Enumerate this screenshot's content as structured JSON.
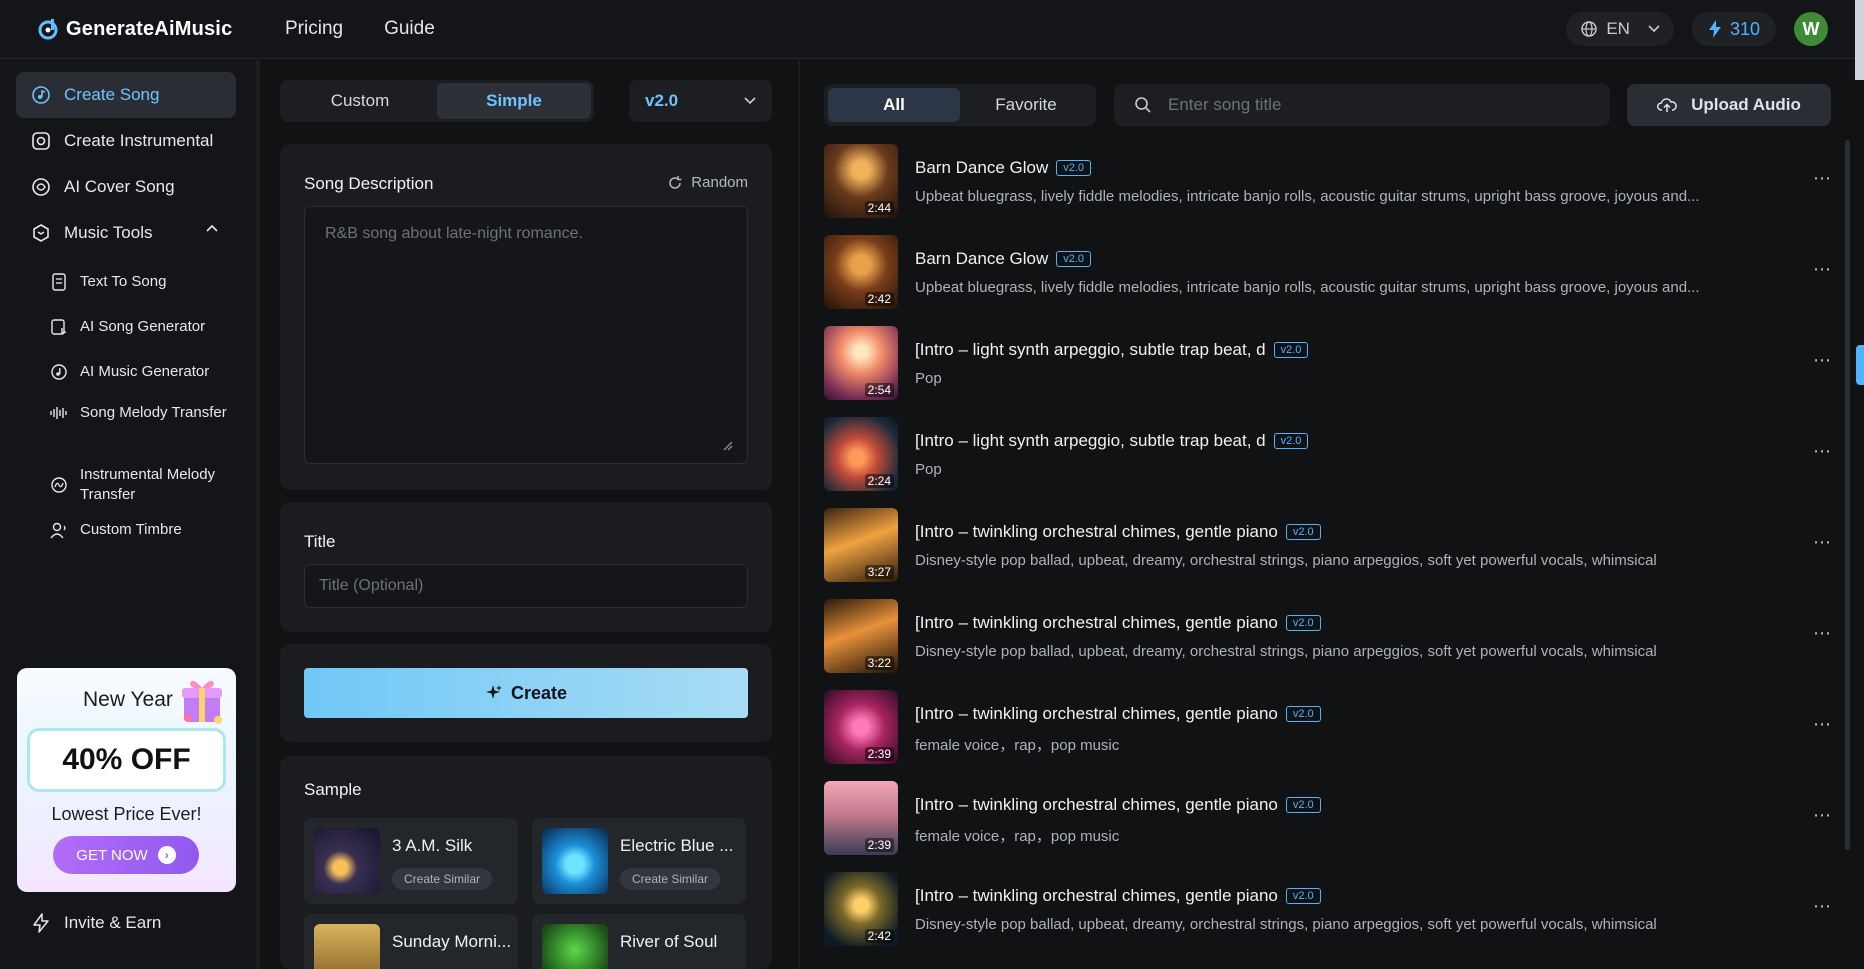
{
  "header": {
    "logo": "GenerateAiMusic",
    "nav": [
      "Pricing",
      "Guide"
    ],
    "language": "EN",
    "credits": "310",
    "avatar_initial": "W"
  },
  "sidebar": {
    "items": [
      {
        "label": "Create Song",
        "icon": "music-note-circle-icon"
      },
      {
        "label": "Create Instrumental",
        "icon": "instrument-icon"
      },
      {
        "label": "AI Cover Song",
        "icon": "cover-song-icon"
      },
      {
        "label": "Music Tools",
        "icon": "tools-icon"
      }
    ],
    "sub_items": [
      {
        "label": "Text To Song",
        "icon": "document-icon"
      },
      {
        "label": "AI Song Generator",
        "icon": "song-generator-icon"
      },
      {
        "label": "AI Music Generator",
        "icon": "music-generator-icon"
      },
      {
        "label": "Song Melody Transfer",
        "icon": "waveform-icon"
      },
      {
        "label": "Instrumental Melody Transfer",
        "icon": "melody-icon"
      },
      {
        "label": "Custom Timbre",
        "icon": "voice-icon"
      }
    ],
    "promo": {
      "title": "New Year",
      "discount": "40% OFF",
      "subtitle": "Lowest Price Ever!",
      "button": "GET NOW"
    },
    "invite": "Invite & Earn"
  },
  "create": {
    "modes": [
      "Custom",
      "Simple"
    ],
    "active_mode": "Simple",
    "version": "v2.0",
    "description_label": "Song Description",
    "random_label": "Random",
    "description_placeholder": "R&B song about late-night romance.",
    "title_label": "Title",
    "title_placeholder": "Title (Optional)",
    "create_label": "Create",
    "sample_label": "Sample",
    "samples": [
      {
        "name": "3 A.M. Silk",
        "action": "Create Similar"
      },
      {
        "name": "Electric Blue ...",
        "action": "Create Similar"
      },
      {
        "name": "Sunday Morni...",
        "action": ""
      },
      {
        "name": "River of Soul",
        "action": ""
      }
    ]
  },
  "library": {
    "tabs": [
      "All",
      "Favorite"
    ],
    "active_tab": "All",
    "search_placeholder": "Enter song title",
    "upload_label": "Upload Audio",
    "songs": [
      {
        "title": "Barn Dance Glow",
        "version": "v2.0",
        "duration": "2:44",
        "desc": "Upbeat bluegrass, lively fiddle melodies, intricate banjo rolls, acoustic guitar strums, upright bass groove, joyous and..."
      },
      {
        "title": "Barn Dance Glow",
        "version": "v2.0",
        "duration": "2:42",
        "desc": "Upbeat bluegrass, lively fiddle melodies, intricate banjo rolls, acoustic guitar strums, upright bass groove, joyous and..."
      },
      {
        "title": "[Intro – light synth arpeggio, subtle trap beat, d",
        "version": "v2.0",
        "duration": "2:54",
        "desc": "Pop"
      },
      {
        "title": "[Intro – light synth arpeggio, subtle trap beat, d",
        "version": "v2.0",
        "duration": "2:24",
        "desc": "Pop"
      },
      {
        "title": "[Intro – twinkling orchestral chimes, gentle piano",
        "version": "v2.0",
        "duration": "3:27",
        "desc": "Disney-style pop ballad, upbeat, dreamy, orchestral strings, piano arpeggios, soft yet powerful vocals, whimsical"
      },
      {
        "title": "[Intro – twinkling orchestral chimes, gentle piano",
        "version": "v2.0",
        "duration": "3:22",
        "desc": "Disney-style pop ballad, upbeat, dreamy, orchestral strings, piano arpeggios, soft yet powerful vocals, whimsical"
      },
      {
        "title": "[Intro – twinkling orchestral chimes, gentle piano",
        "version": "v2.0",
        "duration": "2:39",
        "desc": "female voice，rap，pop music"
      },
      {
        "title": "[Intro – twinkling orchestral chimes, gentle piano",
        "version": "v2.0",
        "duration": "2:39",
        "desc": "female voice，rap，pop music"
      },
      {
        "title": "[Intro – twinkling orchestral chimes, gentle piano",
        "version": "v2.0",
        "duration": "2:42",
        "desc": "Disney-style pop ballad, upbeat, dreamy, orchestral strings, piano arpeggios, soft yet powerful vocals, whimsical"
      }
    ]
  },
  "colors": {
    "accent": "#6fc3ff",
    "badge": "#4fb3ff",
    "bg": "#111214",
    "panel": "#1a1c20"
  }
}
